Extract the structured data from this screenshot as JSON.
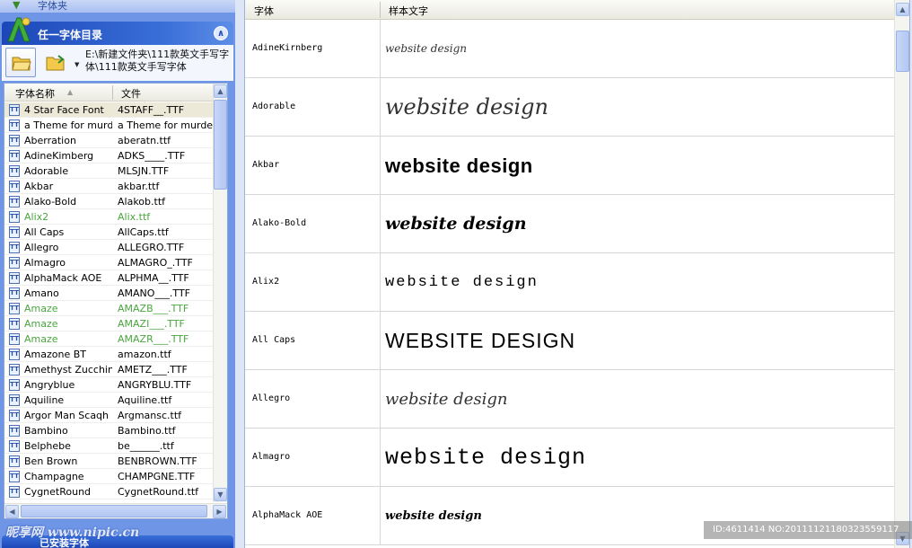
{
  "left_panel": {
    "top_title": "字体夹",
    "section_title": "任一字体目录",
    "folder_path": "E:\\新建文件夹\\111款英文手写字体\\111款英文手写字体",
    "columns": {
      "name": "字体名称",
      "file": "文件"
    },
    "fonts": [
      {
        "name": "4 Star Face Font",
        "file": "4STAFF__.TTF",
        "selected": true
      },
      {
        "name": "a Theme for murder",
        "file": "a Theme for murder.ttf"
      },
      {
        "name": "Aberration",
        "file": "aberatn.ttf"
      },
      {
        "name": "AdineKimberg",
        "file": "ADKS____.TTF"
      },
      {
        "name": "Adorable",
        "file": "MLSJN.TTF"
      },
      {
        "name": "Akbar",
        "file": "akbar.ttf"
      },
      {
        "name": "Alako-Bold",
        "file": "Alakob.ttf"
      },
      {
        "name": "Alix2",
        "file": "Alix.ttf",
        "installed": true
      },
      {
        "name": "All Caps",
        "file": "AllCaps.ttf"
      },
      {
        "name": "Allegro",
        "file": "ALLEGRO.TTF"
      },
      {
        "name": "Almagro",
        "file": "ALMAGRO_.TTF"
      },
      {
        "name": "AlphaMack AOE",
        "file": "ALPHMA__.TTF"
      },
      {
        "name": "Amano",
        "file": "AMANO___.TTF"
      },
      {
        "name": "Amaze",
        "file": "AMAZB___.TTF",
        "installed": true
      },
      {
        "name": "Amaze",
        "file": "AMAZI___.TTF",
        "installed": true
      },
      {
        "name": "Amaze",
        "file": "AMAZR___.TTF",
        "installed": true
      },
      {
        "name": "Amazone BT",
        "file": "amazon.ttf"
      },
      {
        "name": "Amethyst Zucchini",
        "file": "AMETZ___.TTF"
      },
      {
        "name": "Angryblue",
        "file": "ANGRYBLU.TTF"
      },
      {
        "name": "Aquiline",
        "file": "Aquiline.ttf"
      },
      {
        "name": "Argor Man Scaqh",
        "file": "Argmansc.ttf"
      },
      {
        "name": "Bambino",
        "file": "Bambino.ttf"
      },
      {
        "name": "Belphebe",
        "file": "be______.ttf"
      },
      {
        "name": "Ben Brown",
        "file": "BENBROWN.TTF"
      },
      {
        "name": "Champagne",
        "file": "CHAMPGNE.TTF"
      },
      {
        "name": "CygnetRound",
        "file": "CygnetRound.ttf"
      }
    ],
    "bottom_title": "已安装字体"
  },
  "right_panel": {
    "columns": {
      "font": "字体",
      "sample": "样本文字"
    },
    "rows": [
      {
        "font": "AdineKirnberg",
        "sample": "website design",
        "style": "s-adinekirnberg"
      },
      {
        "font": "Adorable",
        "sample": "website design",
        "style": "s-adorable"
      },
      {
        "font": "Akbar",
        "sample": "website design",
        "style": "s-akbar"
      },
      {
        "font": "Alako-Bold",
        "sample": "website design",
        "style": "s-alakobold"
      },
      {
        "font": "Alix2",
        "sample": "website design",
        "style": "s-alix2"
      },
      {
        "font": "All Caps",
        "sample": "WEBSITE DESIGN",
        "style": "s-allcaps"
      },
      {
        "font": "Allegro",
        "sample": "website design",
        "style": "s-allegro"
      },
      {
        "font": "Almagro",
        "sample": "website design",
        "style": "s-almagro"
      },
      {
        "font": "AlphaMack AOE",
        "sample": "website design",
        "style": "s-alphamack"
      }
    ]
  },
  "watermarks": {
    "left": "昵享网 www.nipic.cn",
    "right": "ID:4611414 NO:20111121180323559117"
  },
  "colors": {
    "installed_text": "#4aa63f",
    "header_blue": "#1c47b8",
    "panel_bg": "#6f95e6"
  }
}
